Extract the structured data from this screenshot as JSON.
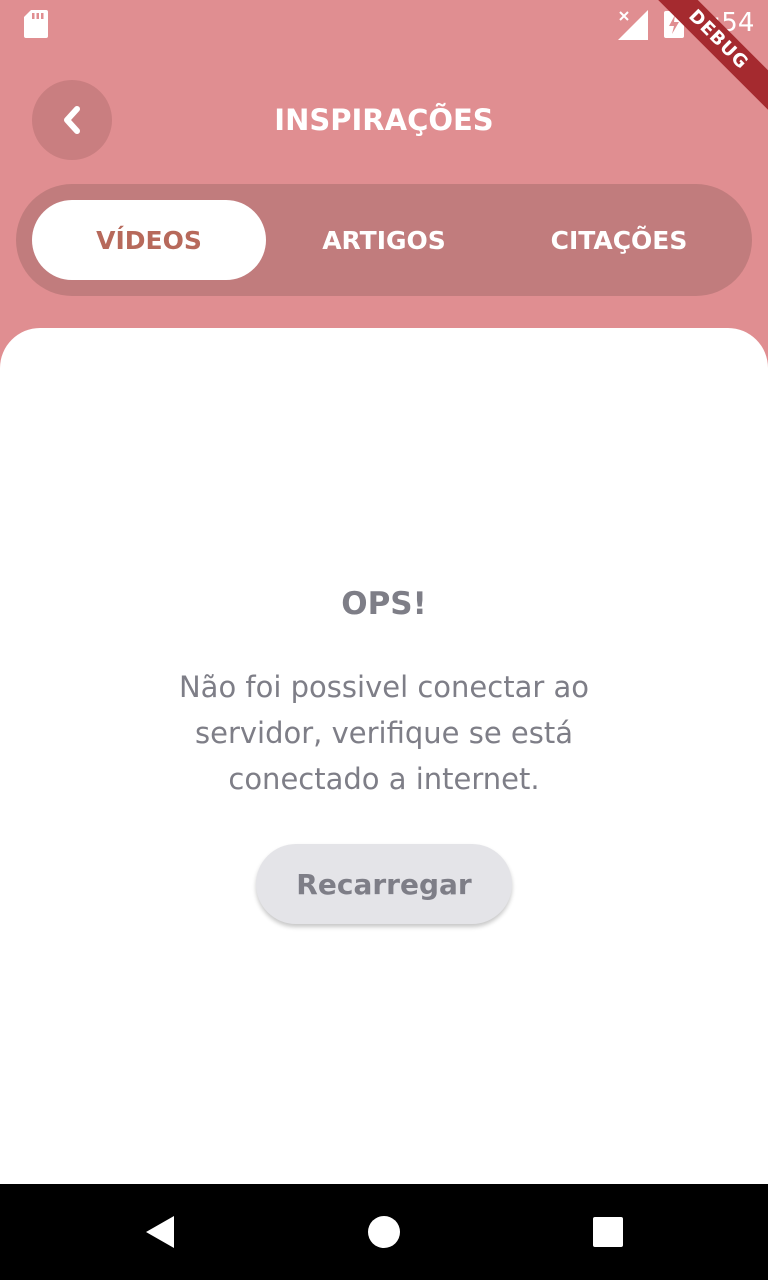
{
  "status_bar": {
    "time": "9:54",
    "debug_label": "DEBUG"
  },
  "header": {
    "title": "INSPIRAÇÕES",
    "back_icon": "chevron-left-icon"
  },
  "tabs": [
    {
      "label": "VÍDEOS",
      "active": true
    },
    {
      "label": "ARTIGOS",
      "active": false
    },
    {
      "label": "CITAÇÕES",
      "active": false
    }
  ],
  "error": {
    "title": "OPS!",
    "message": "Não foi possivel conectar ao servidor, verifique se está conectado a internet.",
    "button_label": "Recarregar"
  },
  "nav_bar": {
    "icons": [
      "back-triangle-icon",
      "home-circle-icon",
      "recents-square-icon"
    ]
  },
  "colors": {
    "header_bg": "#E08E91",
    "tab_track": "#C17C7D",
    "active_tab_text": "#B7695B",
    "body_text": "#7E7E87",
    "button_bg": "#E4E4E8"
  }
}
